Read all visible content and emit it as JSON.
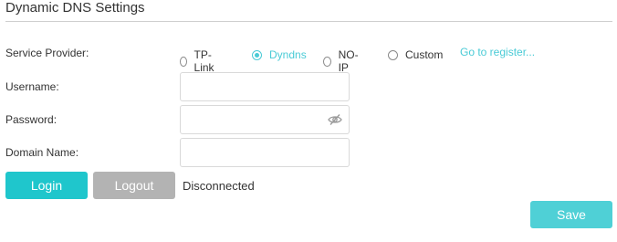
{
  "section": {
    "title": "Dynamic DNS Settings"
  },
  "service_provider": {
    "label": "Service Provider:",
    "options": [
      {
        "label": "TP-Link",
        "checked": false
      },
      {
        "label": "Dyndns",
        "checked": true
      },
      {
        "label": "NO-IP",
        "checked": false
      },
      {
        "label": "Custom",
        "checked": false
      }
    ],
    "register_link": "Go to register..."
  },
  "username": {
    "label": "Username:",
    "value": ""
  },
  "password": {
    "label": "Password:",
    "value": "",
    "icon": "eye-slash-icon"
  },
  "domain_name": {
    "label": "Domain Name:",
    "value": ""
  },
  "actions": {
    "login_label": "Login",
    "logout_label": "Logout",
    "status_text": "Disconnected",
    "save_label": "Save"
  },
  "colors": {
    "accent": "#4acbd6",
    "login_button": "#1fc6cc",
    "logout_button": "#b3b3b3",
    "save_button": "#4fd0d6"
  }
}
